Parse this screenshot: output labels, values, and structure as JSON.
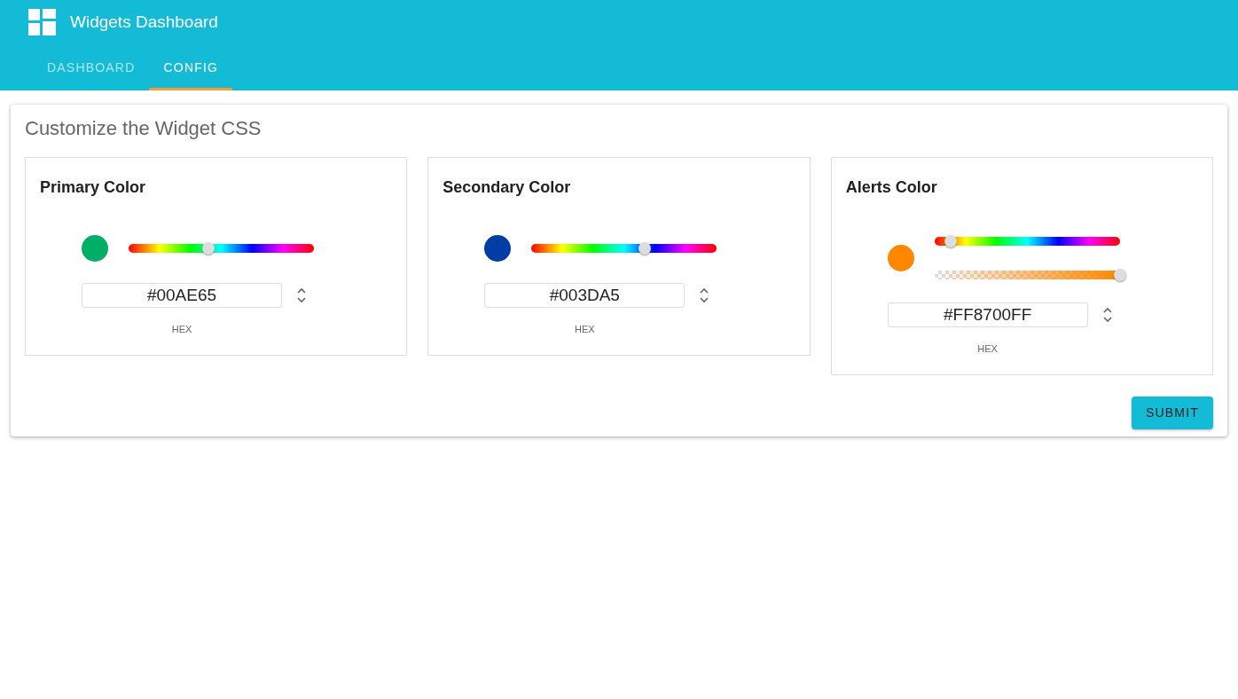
{
  "app": {
    "title": "Widgets Dashboard"
  },
  "tabs": [
    {
      "label": "DASHBOARD",
      "selected": false
    },
    {
      "label": "CONFIG",
      "selected": true
    }
  ],
  "panel": {
    "title": "Customize the Widget CSS",
    "pickers": [
      {
        "title": "Primary Color",
        "color": "#00ae65",
        "sliders": [
          {
            "kind": "hue",
            "level": 0.43
          }
        ],
        "hex": "#00AE65",
        "format": "HEX"
      },
      {
        "title": "Secondary Color",
        "color": "#003da5",
        "sliders": [
          {
            "kind": "hue",
            "level": 0.61
          }
        ],
        "hex": "#003DA5",
        "format": "HEX"
      },
      {
        "title": "Alerts Color",
        "color": "#ff8700",
        "sliders": [
          {
            "kind": "hue",
            "level": 0.09
          },
          {
            "kind": "alpha",
            "level": 1
          }
        ],
        "hex": "#FF8700FF",
        "format": "HEX"
      }
    ],
    "submit": "SUBMIT"
  }
}
